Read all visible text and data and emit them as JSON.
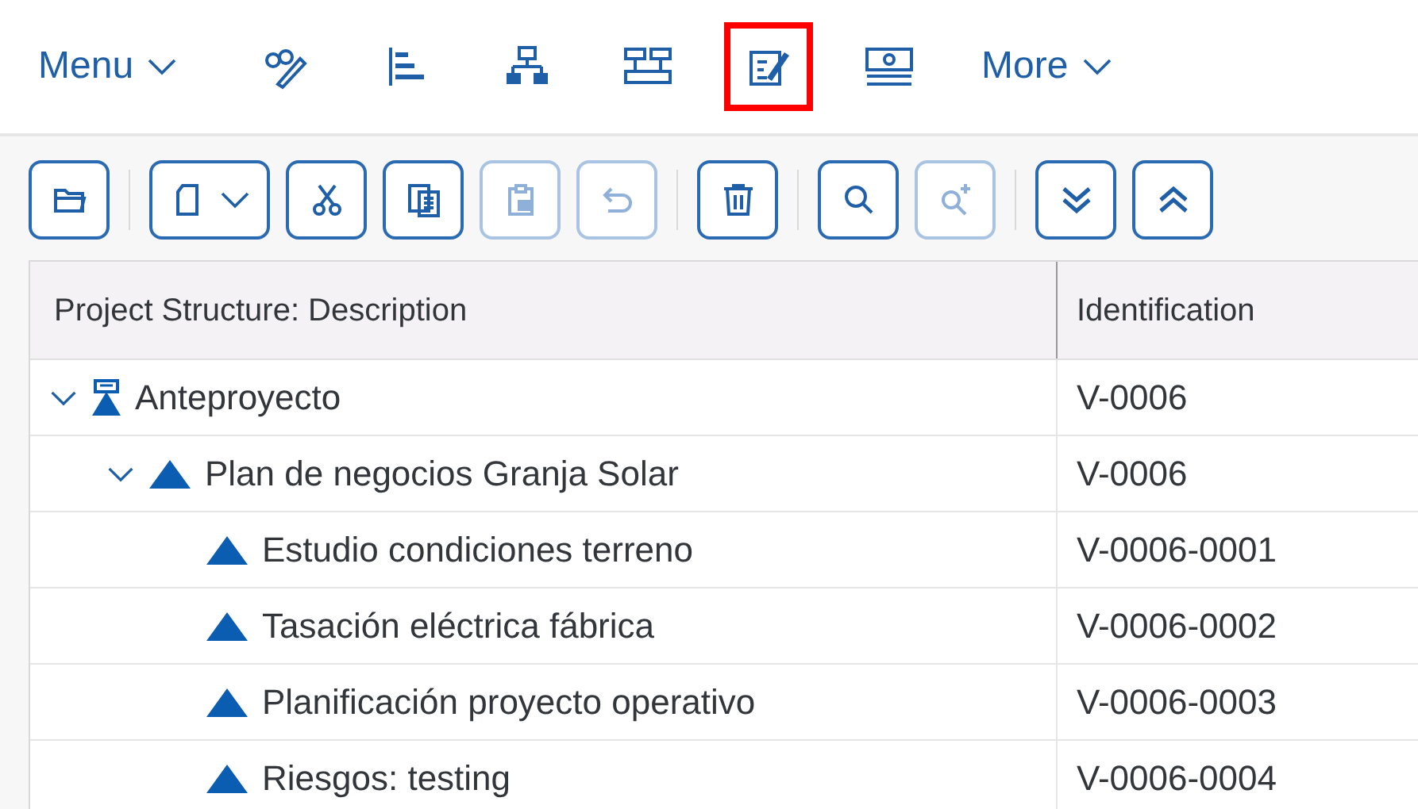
{
  "top_bar": {
    "menu": "Menu",
    "more": "More",
    "tools": [
      {
        "kind": "glasses-pen",
        "highlighted": false
      },
      {
        "kind": "bars",
        "highlighted": false
      },
      {
        "kind": "hierarchy",
        "highlighted": false
      },
      {
        "kind": "network",
        "highlighted": false
      },
      {
        "kind": "form-edit",
        "highlighted": true
      },
      {
        "kind": "money",
        "highlighted": false
      }
    ]
  },
  "toolbar": [
    {
      "kind": "folder",
      "disabled": false,
      "separator_after": true
    },
    {
      "kind": "new-dropdown",
      "disabled": false,
      "separator_after": false
    },
    {
      "kind": "cut",
      "disabled": false,
      "separator_after": false
    },
    {
      "kind": "copy",
      "disabled": false,
      "separator_after": false
    },
    {
      "kind": "paste",
      "disabled": true,
      "separator_after": false
    },
    {
      "kind": "undo",
      "disabled": true,
      "separator_after": true
    },
    {
      "kind": "delete",
      "disabled": false,
      "separator_after": true
    },
    {
      "kind": "search",
      "disabled": false,
      "separator_after": false
    },
    {
      "kind": "search-plus",
      "disabled": true,
      "separator_after": true
    },
    {
      "kind": "expand-all",
      "disabled": false,
      "separator_after": false
    },
    {
      "kind": "collapse-all",
      "disabled": false,
      "separator_after": false
    }
  ],
  "table": {
    "columns": [
      "Project Structure: Description",
      "Identification"
    ],
    "rows": [
      {
        "kind": "project",
        "description": "Anteproyecto",
        "identification": "V-0006",
        "expanded": true,
        "children": [
          {
            "kind": "wbs",
            "description": "Plan de negocios Granja Solar",
            "identification": "V-0006",
            "expanded": true,
            "children": [
              {
                "kind": "wbs",
                "description": "Estudio condiciones terreno",
                "identification": "V-0006-0001"
              },
              {
                "kind": "wbs",
                "description": "Tasación eléctrica fábrica",
                "identification": "V-0006-0002"
              },
              {
                "kind": "wbs",
                "description": "Planificación proyecto operativo",
                "identification": "V-0006-0003"
              },
              {
                "kind": "wbs",
                "description": "Riesgos: testing",
                "identification": "V-0006-0004"
              }
            ]
          }
        ]
      }
    ]
  }
}
